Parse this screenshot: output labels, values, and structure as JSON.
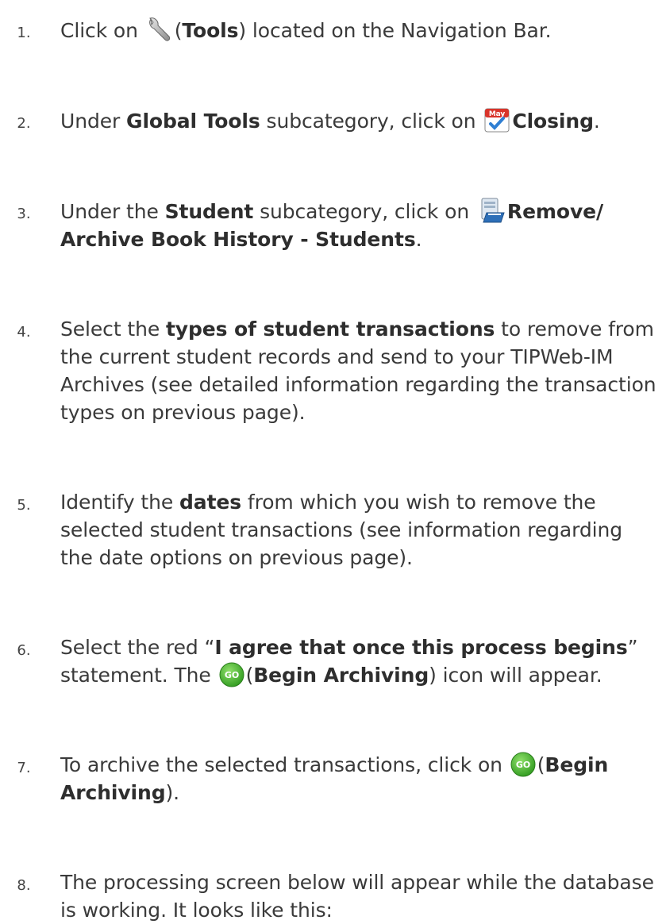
{
  "steps": [
    {
      "num": "1.",
      "a": "Click on ",
      "icon": "wrench-icon",
      "b": "(",
      "bold1": "Tools",
      "c": ") located on the Navigation Bar."
    },
    {
      "num": "2.",
      "a": "Under ",
      "bold1": "Global Tools",
      "b": " subcategory, click on ",
      "icon": "calendar-may-icon",
      "icon_text": "May",
      "bold2": "Closing",
      "c": "."
    },
    {
      "num": "3.",
      "a": "Under the ",
      "bold1": "Student",
      "b": " subcategory, click on ",
      "icon": "archive-book-icon",
      "bold2": "Remove/ Archive Book History - Students",
      "c": "."
    },
    {
      "num": "4.",
      "a": "Select the ",
      "bold1": "types of student transactions",
      "b": " to remove from the current student records and send to your TIPWeb-IM Archives (see detailed information regarding the transaction types on previous page)."
    },
    {
      "num": "5.",
      "a": "Identify the ",
      "bold1": "dates",
      "b": " from which you wish to remove the selected student transactions (see information regarding the date options on previous page)."
    },
    {
      "num": "6.",
      "a": "Select the red “",
      "bold1": "I agree that once this process begins",
      "b": "” statement.  The ",
      "icon": "go-icon",
      "icon_text": "GO",
      "c": "(",
      "bold2": "Begin Archiving",
      "d": ") icon will appear."
    },
    {
      "num": "7.",
      "a": "To archive the selected transactions, click on ",
      "icon": "go-icon",
      "icon_text": "GO",
      "b": "(",
      "bold1": "Begin Archiving",
      "c": ")."
    },
    {
      "num": "8.",
      "a": "The processing screen below will appear while the database is working.  It looks like this:"
    }
  ],
  "colors": {
    "text": "#3a3a3a",
    "go_green": "#3fae2a",
    "calendar_red": "#d9342b"
  }
}
